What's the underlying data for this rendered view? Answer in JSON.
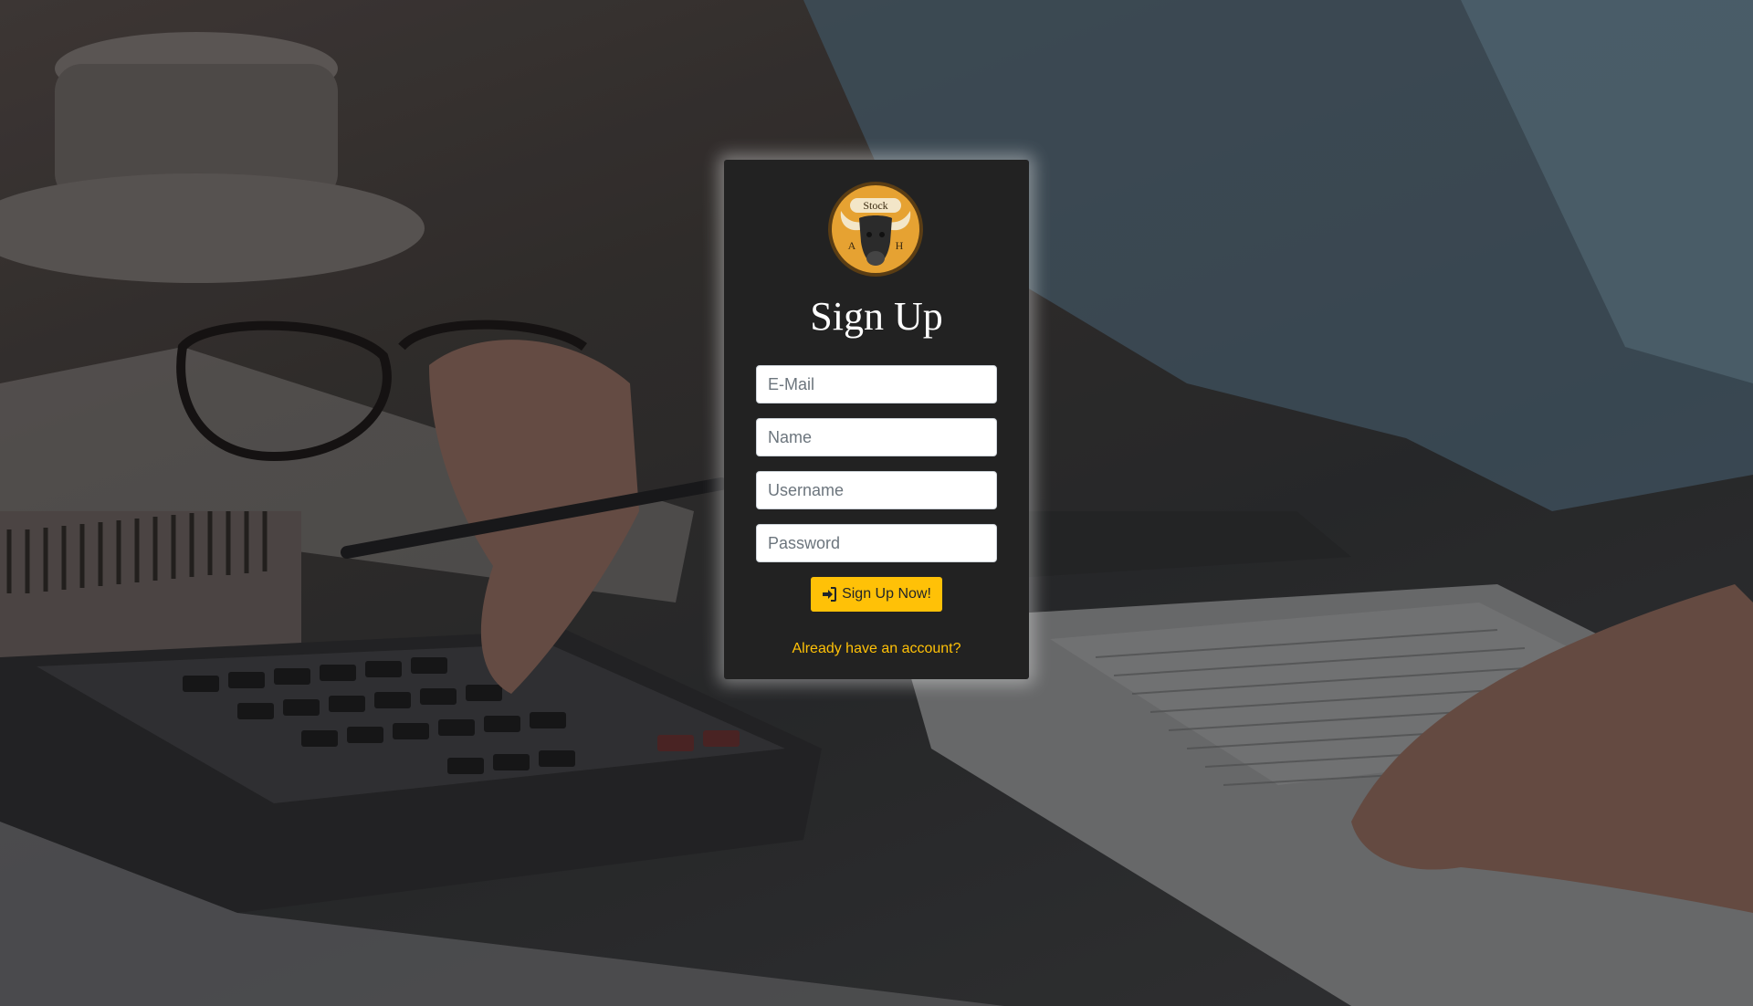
{
  "page": {
    "heading": "Sign Up",
    "logo": {
      "text_top": "Stock",
      "text_left": "A",
      "text_right": "H",
      "icon": "bull-logo-icon"
    }
  },
  "form": {
    "email_placeholder": "E-Mail",
    "name_placeholder": "Name",
    "username_placeholder": "Username",
    "password_placeholder": "Password",
    "submit_label": "Sign Up Now!",
    "submit_icon": "sign-in-icon"
  },
  "footer": {
    "login_link": "Already have an account?"
  },
  "colors": {
    "accent": "#ffc107",
    "card_bg": "#222222",
    "logo_gold": "#e6a232"
  }
}
